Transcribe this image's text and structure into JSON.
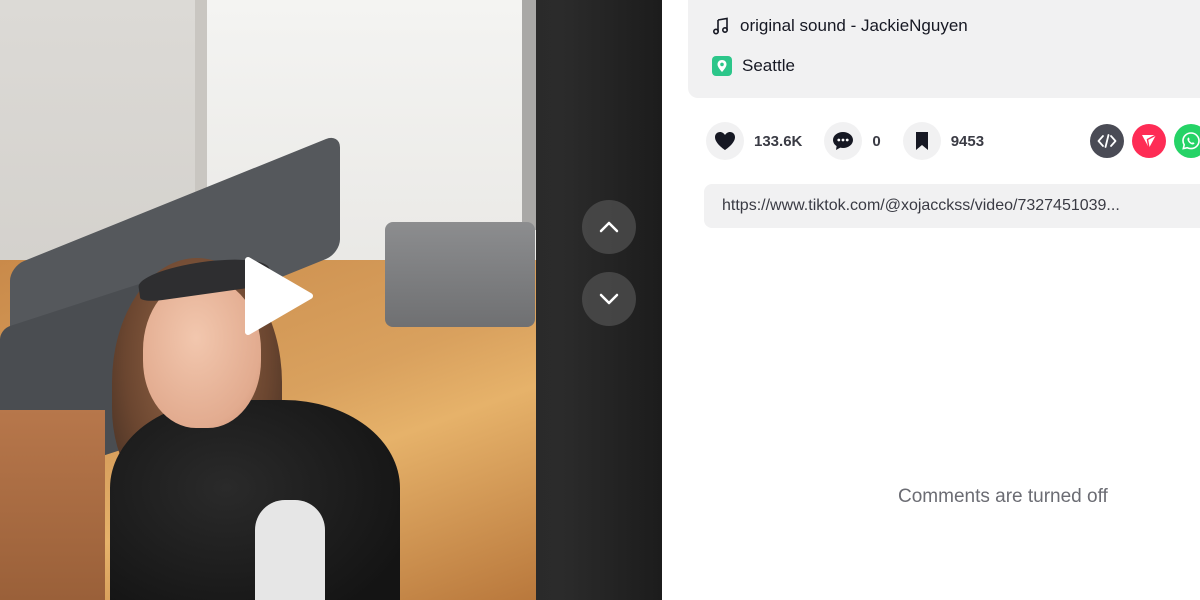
{
  "video": {
    "play_icon": "play-icon",
    "nav_up_icon": "chevron-up-icon",
    "nav_down_icon": "chevron-down-icon"
  },
  "info": {
    "sound_icon": "music-note-icon",
    "sound": "original sound - JackieNguyen",
    "location_icon": "location-pin-icon",
    "location": "Seattle"
  },
  "actions": {
    "likes": "133.6K",
    "comments": "0",
    "saves": "9453"
  },
  "share": {
    "embed_icon": "embed-code-icon",
    "send_icon": "send-icon",
    "whatsapp_icon": "whatsapp-icon"
  },
  "link": {
    "url": "https://www.tiktok.com/@xojacckss/video/7327451039..."
  },
  "comments": {
    "status": "Comments are turned off"
  },
  "colors": {
    "accent": "#fe2c55",
    "location": "#2cc68a",
    "whatsapp": "#25d366"
  }
}
